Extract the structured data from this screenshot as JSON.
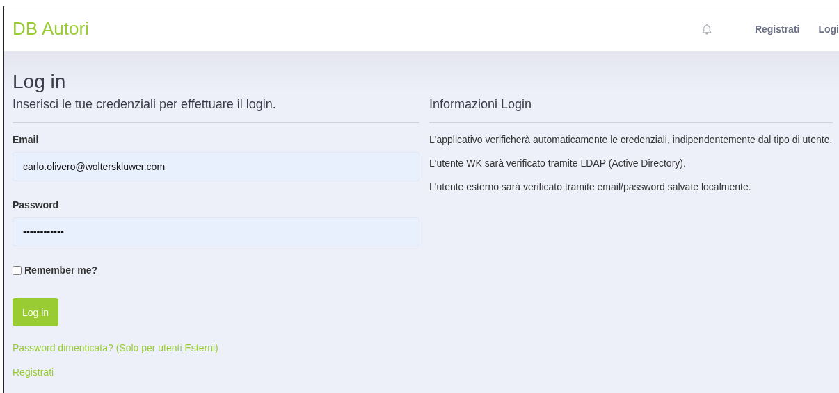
{
  "navbar": {
    "brand": "DB Autori",
    "links": [
      {
        "label": "Registrati"
      },
      {
        "label": "Logi"
      }
    ]
  },
  "login": {
    "title": "Log in",
    "subtitle": "Inserisci le tue credenziali per effettuare il login.",
    "email": {
      "label": "Email",
      "value": "carlo.olivero@wolterskluwer.com"
    },
    "password": {
      "label": "Password",
      "value": "••••••••••••"
    },
    "remember": {
      "label": "Remember me?",
      "checked": false
    },
    "submit": "Log in",
    "links": [
      "Password dimenticata? (Solo per utenti Esterni)",
      "Registrati"
    ]
  },
  "info": {
    "title": "Informazioni Login",
    "paragraphs": [
      "L'applicativo verificherà automaticamente le credenziali, indipendentemente dal tipo di utente.",
      "L'utente WK sarà verificato tramite LDAP (Active Directory).",
      "L'utente esterno sarà verificato tramite email/password salvate localmente."
    ]
  }
}
